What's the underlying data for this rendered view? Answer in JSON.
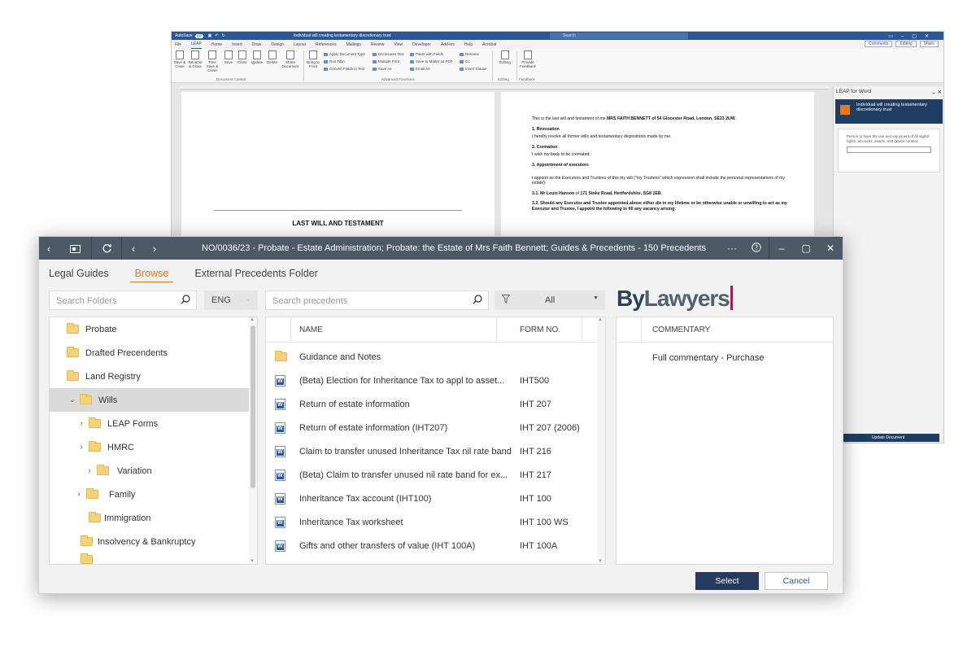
{
  "word": {
    "autosave": "AutoSave",
    "autosave_state": "Off",
    "doc_title": "Individual will creating testamentary discretionary trust",
    "search_placeholder": "Search",
    "menu_tabs": [
      "File",
      "LEAP",
      "Home",
      "Insert",
      "Draw",
      "Design",
      "Layout",
      "References",
      "Mailings",
      "Review",
      "View",
      "Developer",
      "Add-ins",
      "Help",
      "Acrobat"
    ],
    "active_tab": "LEAP",
    "right_actions": [
      "Comments",
      "Editing",
      "Share"
    ],
    "ribbon": {
      "big_buttons": [
        "Save & Close",
        "Rename & Close",
        "Time Save & Close",
        "Save",
        "Close",
        "Update",
        "Delete",
        "Share Document",
        "Bring to Front",
        "Editing",
        "Provide Feedback"
      ],
      "small_buttons": [
        "Apply Document Type",
        "Run Fillin",
        "Convert Fields to Text",
        "Enclosures Text",
        "Multiple Print",
        "Save As",
        "Paste with Fields",
        "Save to Matter as PDF",
        "Email As",
        "Rename",
        "Cc",
        "Insert Clause"
      ],
      "groups": [
        "Document Control",
        "Advanced Functions",
        "Editing",
        "Feedback"
      ]
    },
    "page1_title": "LAST WILL AND TESTAMENT",
    "page2": {
      "intro_pre": "This is the last will and testament of me ",
      "intro_bold": "MRS FAITH BENNETT of 54 Glocester Road, London, SE23 2UW.",
      "h1": "1.  Revocation",
      "p1": "I hereby revoke all former wills and testamentary dispositions made by me.",
      "h2": "2.  Cremation",
      "p2": "I wish my body to be cremated.",
      "h3": "3.  Appointment of executors",
      "p3": "I appoint as the Executors and Trustees of this my will (\"my Trustees\" which expression shall include the personal representatives of my estate):",
      "p4_pre": "3.1. Mr Louis Hanson",
      "p4_mid": " of ",
      "p4_bold": "171 Stoke Road, Hertfordshire, SG8 1ER.",
      "p5": "3.2. Should any Executor and Trustee appointed above either die in my lifetime or be otherwise unable or unwilling  to act as my Executor and Trustee, I appoint the following to fill any vacancy arising:"
    },
    "leap_pane": {
      "title": "LEAP for Word",
      "banner": "Individual will creating testamentary discretionary trust",
      "field_label": "Person to have the use and enjoyment of all digital rights, accounts, assets, and device content:",
      "update_button": "Update Document"
    }
  },
  "dialog": {
    "title": "NO/0036/23 - Probate - Estate Administration; Probate: the Estate of Mrs Faith Bennett; Guides & Precedents - 150 Precedents",
    "tabs": [
      "Legal Guides",
      "Browse",
      "External Precedents Folder"
    ],
    "active_tab": "Browse",
    "search_folders_placeholder": "Search Folders",
    "language": "ENG",
    "search_precedents_placeholder": "Search precedents",
    "filter": "All",
    "brand_by": "By",
    "brand_lawyers": "Lawyers",
    "folders": [
      {
        "label": "Probate",
        "level": 0,
        "arrow": ""
      },
      {
        "label": "Drafted Precendents",
        "level": 0,
        "arrow": ""
      },
      {
        "label": "Land Registry",
        "level": 0,
        "arrow": ""
      },
      {
        "label": "Wills",
        "level": 1,
        "arrow": "expanded",
        "selected": true
      },
      {
        "label": "LEAP Forms",
        "level": 2,
        "arrow": "collapsed"
      },
      {
        "label": "HMRC",
        "level": 2,
        "arrow": "collapsed"
      },
      {
        "label": "Variation",
        "level": 3,
        "arrow": "collapsed"
      },
      {
        "label": "Family",
        "level": 2,
        "arrow": "collapsed"
      },
      {
        "label": "Immigration",
        "level": 3,
        "arrow": ""
      },
      {
        "label": "Insolvency & Bankruptcy",
        "level": 2,
        "arrow": ""
      }
    ],
    "columns": {
      "name": "NAME",
      "form_no": "FORM NO."
    },
    "precedents": [
      {
        "name": "Guidance and Notes",
        "form": "",
        "type": "folder"
      },
      {
        "name": "(Beta) Election for Inheritance Tax to appl to asset...",
        "form": "IHT500",
        "type": "doc"
      },
      {
        "name": "Return of estate information",
        "form": "IHT 207",
        "type": "doc"
      },
      {
        "name": "Return of estate information (IHT207)",
        "form": "IHT 207 (2006)",
        "type": "doc"
      },
      {
        "name": "Claim to transfer unused Inheritance Tax nil rate band",
        "form": "IHT 216",
        "type": "doc"
      },
      {
        "name": "(Beta) Claim to transfer unused nil rate band for ex...",
        "form": "IHT 217",
        "type": "doc"
      },
      {
        "name": "Inheritance Tax account (IHT100)",
        "form": "IHT 100",
        "type": "doc"
      },
      {
        "name": "Inheritance Tax worksheet",
        "form": "IHT 100 WS",
        "type": "doc"
      },
      {
        "name": "Gifts and other transfers of value (IHT 100A)",
        "form": "IHT 100A",
        "type": "doc"
      }
    ],
    "commentary_header": "COMMENTARY",
    "commentary_items": [
      "Full commentary - Purchase"
    ],
    "select_button": "Select",
    "cancel_button": "Cancel"
  }
}
